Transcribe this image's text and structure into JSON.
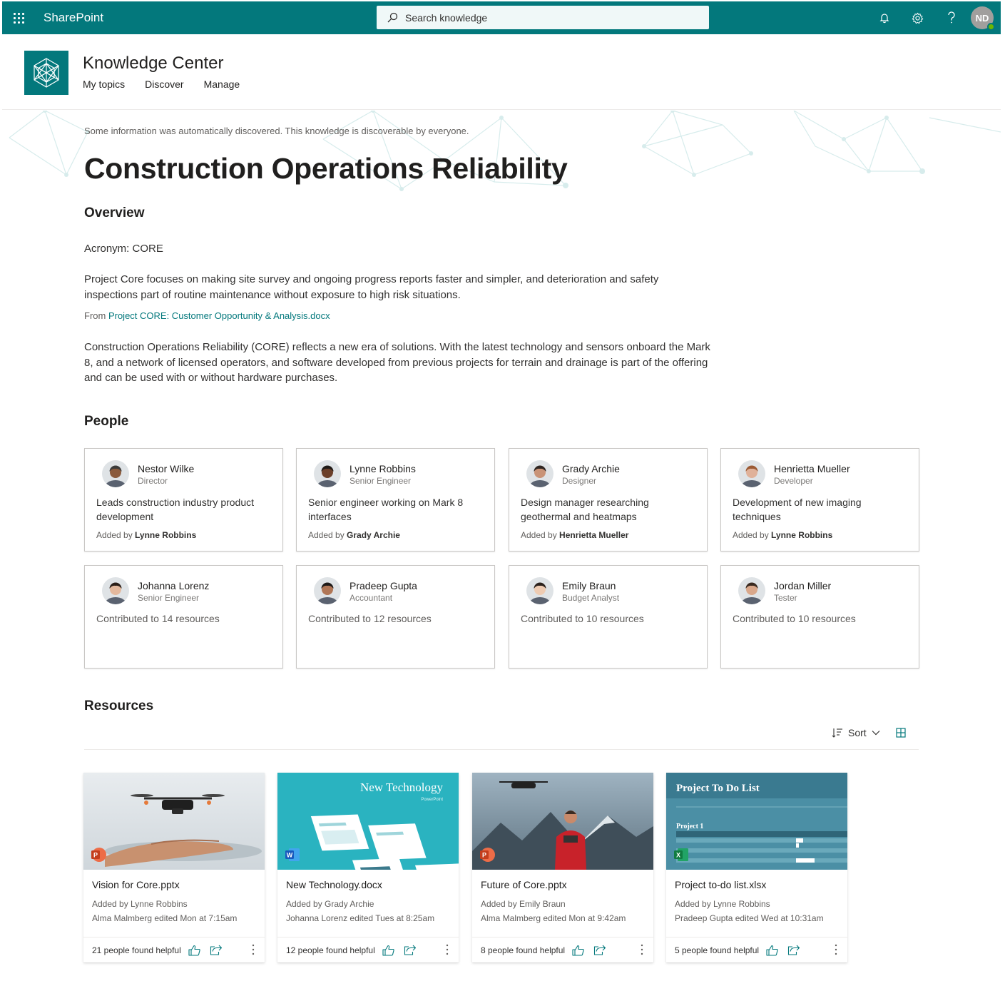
{
  "suite": {
    "brand": "SharePoint",
    "search_placeholder": "Search knowledge",
    "user_initials": "ND"
  },
  "site": {
    "title": "Knowledge Center",
    "nav": [
      "My topics",
      "Discover",
      "Manage"
    ]
  },
  "topic": {
    "notice": "Some information was automatically discovered. This knowledge is discoverable by everyone.",
    "title": "Construction Operations Reliability",
    "overview_heading": "Overview",
    "acronym": "Acronym: CORE",
    "paragraph1": "Project Core focuses on making site survey and ongoing progress reports faster and simpler, and deterioration and safety inspections part of routine maintenance without exposure to high risk situations.",
    "from_prefix": "From ",
    "from_link": "Project CORE: Customer Opportunity & Analysis.docx",
    "paragraph2": "Construction Operations Reliability (CORE) reflects a new era of solutions. With the latest technology and sensors onboard the Mark 8, and a network of licensed operators, and software developed from previous projects for terrain and drainage is part of the offering and can be used with or without hardware purchases."
  },
  "people": {
    "heading": "People",
    "added_prefix": "Added by ",
    "cards": [
      {
        "name": "Nestor Wilke",
        "role": "Director",
        "desc": "Leads construction industry product development",
        "added_by": "Lynne Robbins",
        "skin": "#8a5a3c",
        "hair": "#3b3b3b"
      },
      {
        "name": "Lynne Robbins",
        "role": "Senior Engineer",
        "desc": "Senior engineer working on Mark 8 interfaces",
        "added_by": "Grady Archie",
        "skin": "#6b3f2a",
        "hair": "#1f1a17"
      },
      {
        "name": "Grady Archie",
        "role": "Designer",
        "desc": "Design manager researching geothermal and heatmaps",
        "added_by": "Henrietta Mueller",
        "skin": "#c99377",
        "hair": "#2f2622"
      },
      {
        "name": "Henrietta Mueller",
        "role": "Developer",
        "desc": "Development of new imaging techniques",
        "added_by": "Lynne Robbins",
        "skin": "#e0b199",
        "hair": "#9b5a34"
      },
      {
        "name": "Johanna Lorenz",
        "role": "Senior Engineer",
        "contrib": "Contributed to 14 resources",
        "skin": "#e3b89d",
        "hair": "#2a1e18"
      },
      {
        "name": "Pradeep Gupta",
        "role": "Accountant",
        "contrib": "Contributed to 12 resources",
        "skin": "#b07656",
        "hair": "#1e1a18"
      },
      {
        "name": "Emily Braun",
        "role": "Budget Analyst",
        "contrib": "Contributed to 10 resources",
        "skin": "#eecbb2",
        "hair": "#2b211c"
      },
      {
        "name": "Jordan Miller",
        "role": "Tester",
        "contrib": "Contributed to 10 resources",
        "skin": "#d9a78a",
        "hair": "#3a2a20"
      }
    ]
  },
  "resources": {
    "heading": "Resources",
    "sort_label": "Sort",
    "cards": [
      {
        "title": "Vision for Core.pptx",
        "added": "Added by Lynne Robbins",
        "edited": "Alma Malmberg edited Mon at 7:15am",
        "helpful": "21 people found helpful",
        "type": "pptx"
      },
      {
        "title": "New Technology.docx",
        "added": "Added by Grady Archie",
        "edited": "Johanna Lorenz edited Tues at 8:25am",
        "helpful": "12 people found helpful",
        "type": "docx",
        "thumb_title": "New Technology",
        "thumb_sub": "PowerPoint"
      },
      {
        "title": "Future of Core.pptx",
        "added": "Added by Emily Braun",
        "edited": "Alma Malmberg edited Mon at 9:42am",
        "helpful": "8 people found helpful",
        "type": "pptx"
      },
      {
        "title": "Project to-do list.xlsx",
        "added": "Added by Lynne Robbins",
        "edited": "Pradeep Gupta edited Wed at 10:31am",
        "helpful": "5 people found helpful",
        "type": "xlsx",
        "thumb_title": "Project To Do List",
        "thumb_sub": "Project 1"
      }
    ]
  },
  "colors": {
    "brand": "#03787c",
    "ppt": "#c43e1c",
    "word": "#185abd",
    "excel": "#107c41"
  }
}
